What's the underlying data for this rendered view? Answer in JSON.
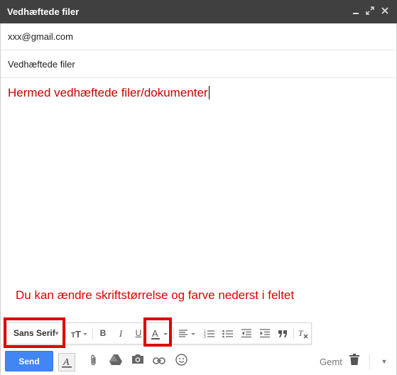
{
  "window": {
    "title": "Vedhæftede filer"
  },
  "compose": {
    "to": "xxx@gmail.com",
    "subject": "Vedhæftede filer",
    "body": "Hermed vedhæftede filer/dokumenter"
  },
  "annotation": {
    "hint": "Du kan ændre skriftstørrelse og farve nederst i feltet"
  },
  "formatting": {
    "font_family": "Sans Serif"
  },
  "actions": {
    "send_label": "Send",
    "saved_label": "Gemt"
  },
  "colors": {
    "accent": "#4285f4",
    "highlight": "#e00000",
    "body_text": "#cc0000",
    "titlebar": "#404040"
  }
}
